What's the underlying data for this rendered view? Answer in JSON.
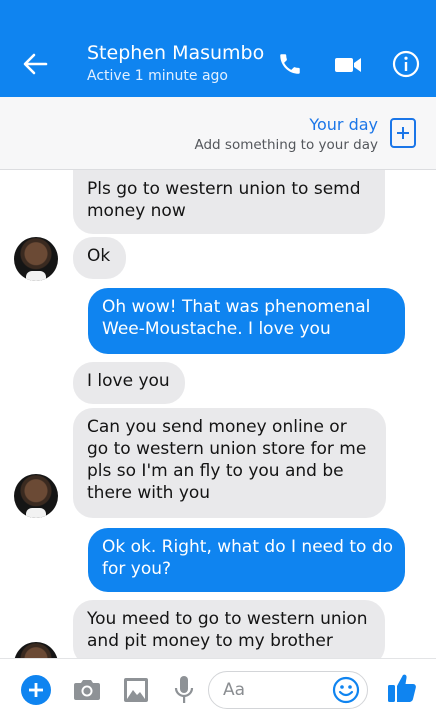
{
  "header": {
    "contact_name": "Stephen Masumbo",
    "status": "Active 1 minute ago",
    "accent": "#0f84f0"
  },
  "your_day": {
    "title": "Your day",
    "subtitle": "Add something to your day"
  },
  "messages": [
    {
      "from": "them",
      "lines": [
        "Pls go to western union to semd",
        "money now"
      ]
    },
    {
      "from": "them",
      "lines": [
        "Ok"
      ]
    },
    {
      "from": "me",
      "lines": [
        "Oh wow! That was phenomenal",
        "Wee-Moustache. I love you"
      ]
    },
    {
      "from": "them",
      "lines": [
        "I love you"
      ]
    },
    {
      "from": "them",
      "lines": [
        "Can you send money online or",
        "go to western union store for me",
        "pls so I'm an fly to you and be",
        "there with you"
      ]
    },
    {
      "from": "me",
      "lines": [
        "Ok ok. Right, what do I need to do",
        "for you?"
      ]
    },
    {
      "from": "them",
      "lines": [
        "You meed to go to western union",
        "and pit money to my brother"
      ]
    }
  ],
  "composer": {
    "placeholder": "Aa",
    "icons": [
      "plus-icon",
      "camera-icon",
      "image-icon",
      "microphone-icon",
      "emoji-icon",
      "thumbs-up-icon"
    ]
  }
}
